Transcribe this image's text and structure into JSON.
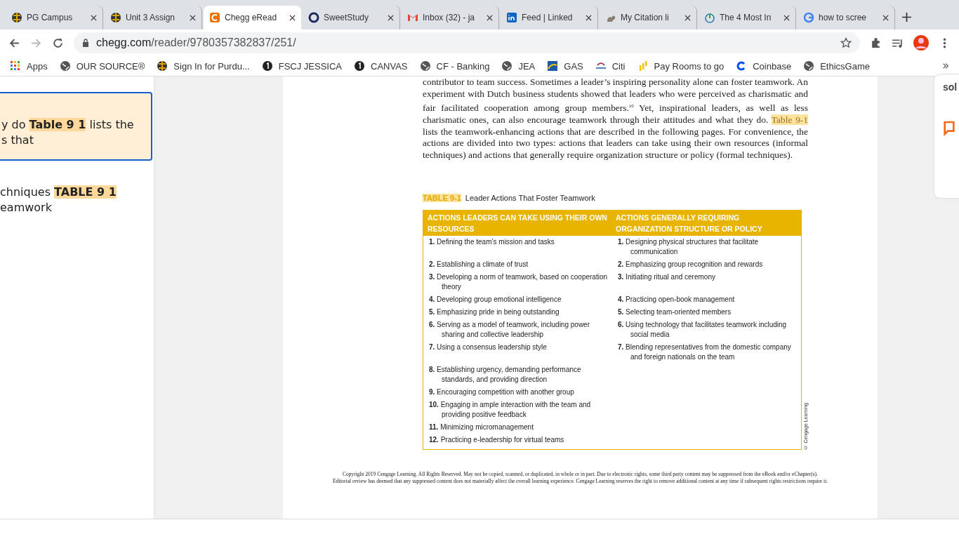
{
  "tabs": [
    {
      "title": "PG Campus",
      "selected": false
    },
    {
      "title": "Unit 3 Assign",
      "selected": false
    },
    {
      "title": "Chegg eRead",
      "selected": true
    },
    {
      "title": "SweetStudy",
      "selected": false
    },
    {
      "title": "Inbox (32) - ja",
      "selected": false
    },
    {
      "title": "Feed | Linked",
      "selected": false
    },
    {
      "title": "My Citation li",
      "selected": false
    },
    {
      "title": "The 4 Most In",
      "selected": false
    },
    {
      "title": "how to scree",
      "selected": false
    }
  ],
  "address": {
    "host": "chegg.com",
    "path": "/reader/9780357382837/251/"
  },
  "bookmarks": [
    "Apps",
    "OUR SOURCE®",
    "Sign In for Purdu...",
    "FSCJ JESSICA",
    "CANVAS",
    "CF - Banking",
    "JEA",
    "GAS",
    "Citi",
    "Pay Rooms to go",
    "Coinbase",
    "EthicsGame"
  ],
  "sidebar": {
    "card_lines": [
      "y do **Table 9 1** lists the",
      "s that"
    ],
    "result_lines": [
      "chniques **TABLE 9 1**",
      "eamwork"
    ]
  },
  "right_panel": {
    "text": "sol"
  },
  "page": {
    "paragraph": {
      "before": "contributor to team success. Sometimes a leader’s inspiring personality alone can foster teamwork. An experiment with Dutch business students showed that leaders who were perceived as charismatic and fair facilitated cooperation among group members.$^{10}$ Yet, inspirational leaders, as well as less charismatic ones, can also encourage teamwork through their attitudes and what they do.",
      "highlight": "Table 9-1",
      "after": "lists the teamwork-enhancing actions that are described in the following pages. For convenience, the actions are divided into two types: actions that leaders can take using their own resources (informal techniques) and actions that generally require organization structure or policy (formal techniques)."
    },
    "table": {
      "label": "TABLE 9-1",
      "title": "Leader Actions That Foster Teamwork",
      "columns": [
        "ACTIONS LEADERS CAN TAKE USING THEIR OWN RESOURCES",
        "ACTIONS GENERALLY REQUIRING ORGANIZATION STRUCTURE OR POLICY"
      ],
      "rows": [
        [
          "**1.** Defining the team’s mission and tasks",
          "**1.** Designing physical structures that facilitate communication"
        ],
        [
          "**2.** Establishing a climate of trust",
          "**2.** Emphasizing group recognition and rewards"
        ],
        [
          "**3.** Developing a norm of teamwork, based on cooperation theory",
          "**3.** Initiating ritual and ceremony"
        ],
        [
          "**4.** Developing group emotional intelligence",
          "**4.** Practicing open-book management"
        ],
        [
          "**5.** Emphasizing pride in being outstanding",
          "**5.** Selecting team-oriented members"
        ],
        [
          "**6.** Serving as a model of teamwork, including power sharing and collective leadership",
          "**6.** Using technology that facilitates teamwork including social media"
        ],
        [
          "**7.** Using a consensus leadership style",
          "**7.** Blending representatives from the domestic company and foreign nationals on the team"
        ],
        [
          "**8.** Establishing urgency, demanding performance standards, and providing direction"
        ],
        [
          "**9.** Encouraging competition with another group"
        ],
        [
          "**10.** Engaging in ample interaction with the team and providing positive feedback"
        ],
        [
          "**11.** Minimizing micromanagement"
        ],
        [
          "**12.** Practicing e-leadership for virtual teams"
        ]
      ],
      "credit": "© Cengage Learning"
    },
    "footer": [
      "Copyright 2019 Cengage Learning. All Rights Reserved. May not be copied, scanned, or duplicated, in whole or in part. Due to electronic rights, some third party content may be suppressed from the eBook and/or eChapter(s).",
      "Editorial review has deemed that any suppressed content does not materially affect the overall learning experience. Cengage Learning reserves the right to remove additional content at any time if subsequent rights restrictions require it."
    ]
  }
}
